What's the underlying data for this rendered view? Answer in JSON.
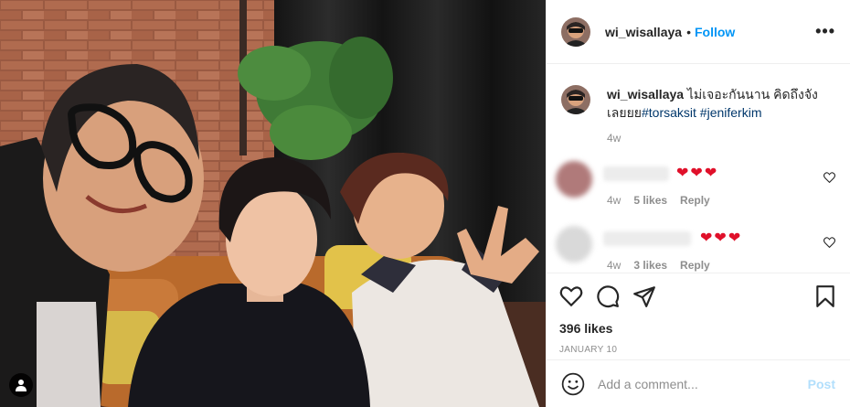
{
  "post": {
    "username": "wi_wisallaya",
    "dot": "•",
    "follow_label": "Follow",
    "more_label": "•••",
    "caption_text": "ไม่เจอะกันนาน คิดถึงจังเลยยย",
    "hashtags": [
      "#torsaksit",
      "#jeniferkim"
    ],
    "caption_time": "4w",
    "likes": "396 likes",
    "date": "JANUARY 10"
  },
  "comments": [
    {
      "hearts": "❤❤❤",
      "time": "4w",
      "likes": "5 likes",
      "reply": "Reply"
    },
    {
      "hearts": "❤❤❤",
      "time": "4w",
      "likes": "3 likes",
      "reply": "Reply"
    }
  ],
  "add_comment": {
    "placeholder": "Add a comment...",
    "post_label": "Post"
  },
  "colors": {
    "link_blue": "#0095f6",
    "hashtag": "#00376b",
    "heart": "#e0102a",
    "muted": "#8e8e8e"
  },
  "icons": [
    "user-tag-icon",
    "more-icon",
    "heart-icon",
    "comment-icon",
    "share-icon",
    "bookmark-icon",
    "emoji-icon"
  ]
}
